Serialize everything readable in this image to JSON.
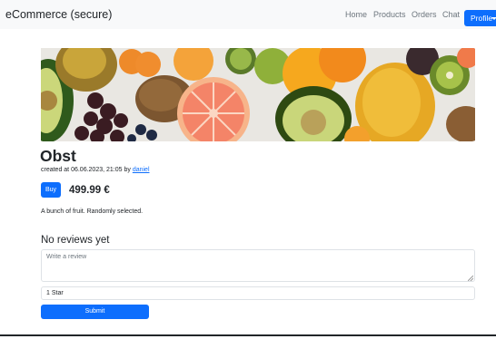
{
  "navbar": {
    "brand": "eCommerce (secure)",
    "links": [
      "Home",
      "Products",
      "Orders",
      "Chat"
    ],
    "profile_label": "Profile"
  },
  "product": {
    "image_alt": "fruit photo",
    "title": "Obst",
    "meta_prefix": "created at 06.06.2023, 21:05 by ",
    "author": "daniel",
    "buy_label": "Buy",
    "price": "499.99 €",
    "description": "A bunch of fruit. Randomly selected."
  },
  "reviews": {
    "heading": "No reviews yet",
    "placeholder": "Write a review",
    "rating_selected": "1 Star",
    "submit_label": "Submit"
  },
  "colors": {
    "primary": "#0d6efd",
    "navbar_bg": "#f8f9fa",
    "muted": "#6c757d"
  }
}
